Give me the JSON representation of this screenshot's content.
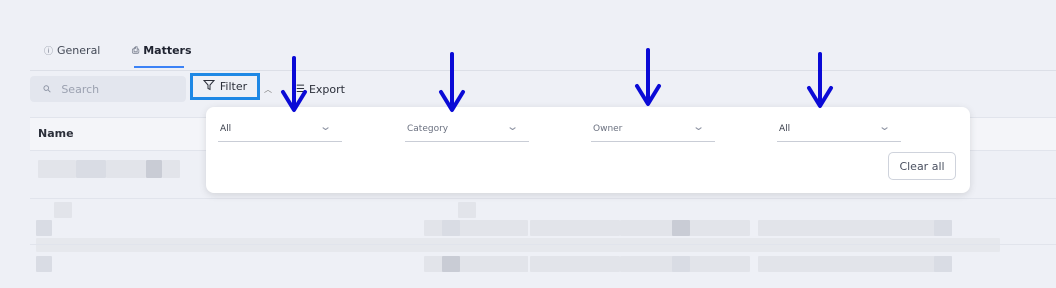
{
  "tabs": [
    {
      "label": "General",
      "icon": "info-icon"
    },
    {
      "label": "Matters",
      "icon": "briefcase-icon"
    }
  ],
  "search": {
    "placeholder": "Search"
  },
  "toolbar": {
    "filter_label": "Filter",
    "export_label": "Export"
  },
  "table": {
    "name_header": "Name"
  },
  "filter_panel": {
    "dropdowns": [
      {
        "value": "All"
      },
      {
        "value": "Category"
      },
      {
        "value": "Owner"
      },
      {
        "value": "All"
      }
    ],
    "clear_label": "Clear all"
  },
  "colors": {
    "accent": "#1e88e5",
    "arrow": "#0a0ad6",
    "tab_underline": "#3b82f6"
  }
}
